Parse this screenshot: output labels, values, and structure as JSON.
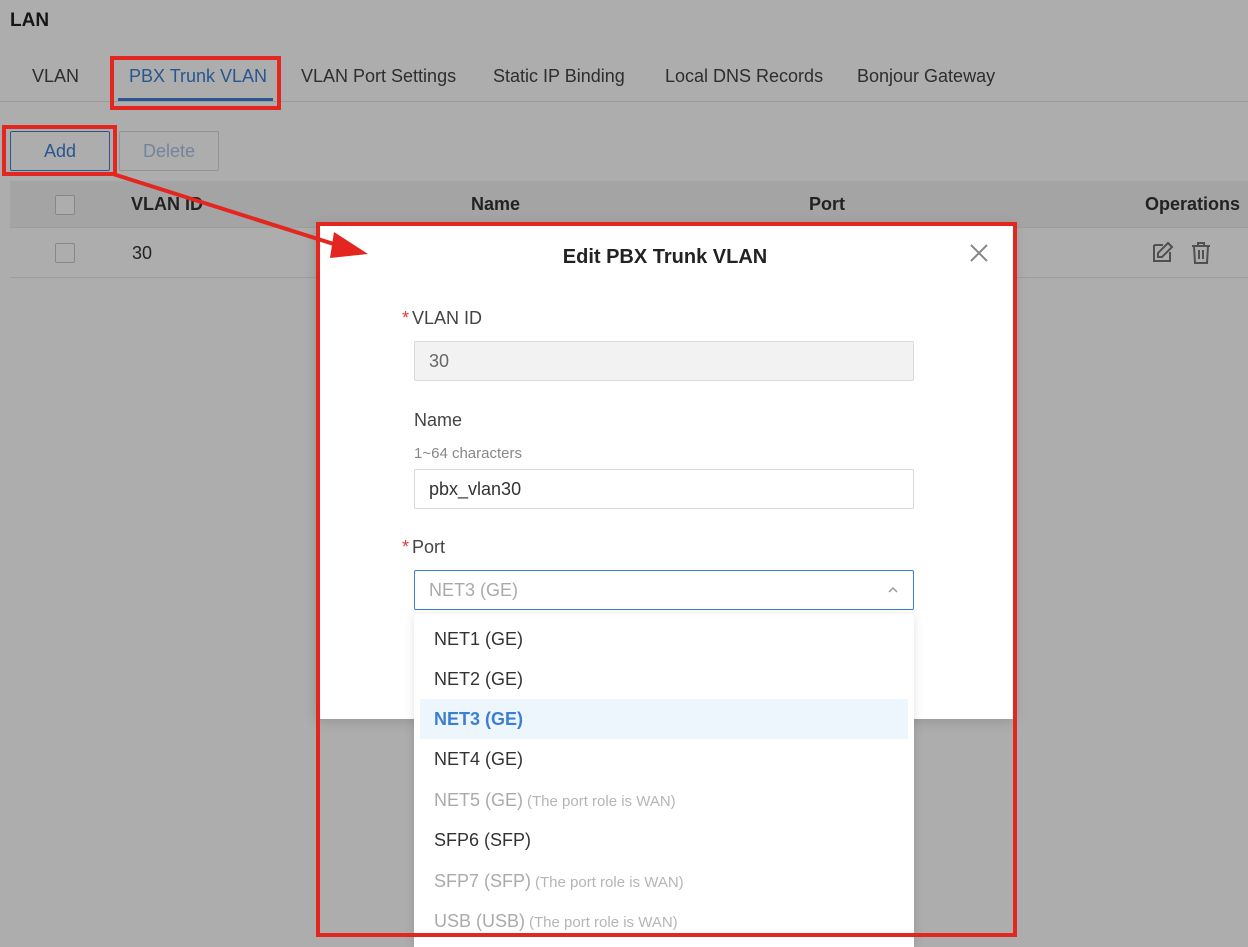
{
  "page": {
    "title": "LAN"
  },
  "tabs": [
    {
      "label": "VLAN"
    },
    {
      "label": "PBX Trunk VLAN",
      "active": true
    },
    {
      "label": "VLAN Port Settings"
    },
    {
      "label": "Static IP Binding"
    },
    {
      "label": "Local DNS Records"
    },
    {
      "label": "Bonjour Gateway"
    }
  ],
  "toolbar": {
    "add_label": "Add",
    "delete_label": "Delete"
  },
  "table": {
    "headers": {
      "vlan_id": "VLAN ID",
      "name": "Name",
      "port": "Port",
      "operations": "Operations"
    },
    "rows": [
      {
        "vlan_id": "30"
      }
    ],
    "icons": {
      "edit": "edit-icon",
      "delete": "trash-icon"
    }
  },
  "modal": {
    "title": "Edit PBX Trunk VLAN",
    "vlan_id": {
      "label": "VLAN ID",
      "required": true,
      "value": "30"
    },
    "name": {
      "label": "Name",
      "hint": "1~64 characters",
      "value": "pbx_vlan30"
    },
    "port": {
      "label": "Port",
      "required": true,
      "value": "NET3 (GE)"
    },
    "port_options": [
      {
        "label": "NET1 (GE)",
        "note": ""
      },
      {
        "label": "NET2 (GE)",
        "note": ""
      },
      {
        "label": "NET3 (GE)",
        "note": "",
        "selected": true
      },
      {
        "label": "NET4 (GE)",
        "note": ""
      },
      {
        "label": "NET5 (GE)",
        "note": "(The port role is WAN)",
        "disabled": true
      },
      {
        "label": "SFP6 (SFP)",
        "note": ""
      },
      {
        "label": "SFP7 (SFP)",
        "note": "(The port role is WAN)",
        "disabled": true
      },
      {
        "label": "USB (USB)",
        "note": "(The port role is WAN)",
        "disabled": true
      }
    ]
  },
  "colors": {
    "accent": "#3b7fd4",
    "highlight": "#e3261f",
    "required": "#e53935"
  }
}
